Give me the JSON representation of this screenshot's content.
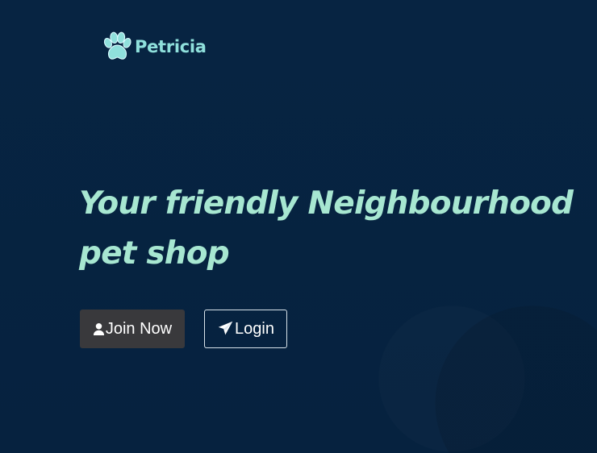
{
  "brand": {
    "name": "Petricia",
    "icon": "paw-icon",
    "color": "#8fe0dc"
  },
  "hero": {
    "title": "Your friendly Neighbourhood pet shop",
    "color": "#a7e7d1"
  },
  "actions": {
    "join": {
      "label": "Join Now",
      "icon": "user-icon",
      "background": "#39393c"
    },
    "login": {
      "label": "Login",
      "icon": "paper-plane-icon",
      "border": "#d8e3ea"
    }
  },
  "theme": {
    "background": "#062340"
  }
}
